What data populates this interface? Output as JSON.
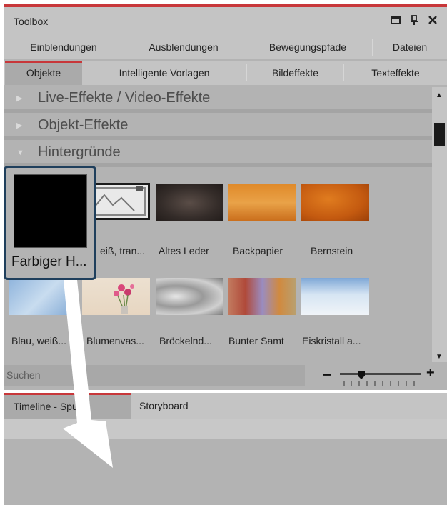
{
  "window": {
    "title": "Toolbox",
    "controls": [
      "maximize-icon",
      "pin-icon",
      "close-icon"
    ],
    "accent_color": "#c8373a"
  },
  "tabs_row1": [
    {
      "label": "Einblendungen"
    },
    {
      "label": "Ausblendungen"
    },
    {
      "label": "Bewegungspfade"
    },
    {
      "label": "Dateien"
    }
  ],
  "tabs_row2": [
    {
      "label": "Objekte",
      "active": true
    },
    {
      "label": "Intelligente Vorlagen"
    },
    {
      "label": "Bildeffekte"
    },
    {
      "label": "Texteffekte"
    }
  ],
  "sections": [
    {
      "label": "Live-Effekte / Video-Effekte",
      "expanded": false
    },
    {
      "label": "Objekt-Effekte",
      "expanded": false
    },
    {
      "label": "Hintergründe",
      "expanded": true
    }
  ],
  "backgrounds": [
    {
      "label": "Farbiger H..."
    },
    {
      "label": "eiß, tran..."
    },
    {
      "label": "Altes Leder"
    },
    {
      "label": "Backpapier"
    },
    {
      "label": "Bernstein"
    },
    {
      "label": "Blau, weiß..."
    },
    {
      "label": "Blumenvas..."
    },
    {
      "label": "Bröckelnd..."
    },
    {
      "label": "Bunter Samt"
    },
    {
      "label": "Eiskristall a..."
    }
  ],
  "search": {
    "placeholder": "Suchen"
  },
  "zoom": {
    "minus": "−",
    "plus": "+"
  },
  "bottom_tabs": [
    {
      "label": "Timeline - Spur",
      "active": true
    },
    {
      "label": "Storyboard"
    }
  ],
  "drag_highlight_color": "#1f3f5c"
}
